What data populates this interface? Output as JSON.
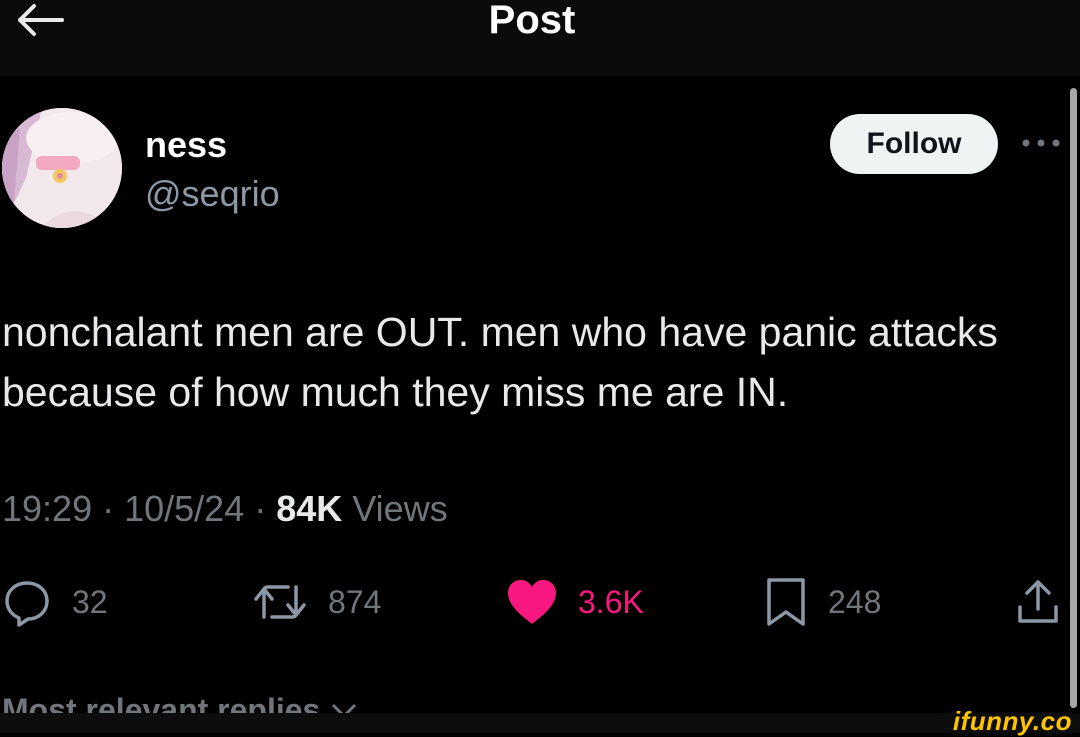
{
  "header": {
    "title": "Post"
  },
  "author": {
    "display_name": "ness",
    "handle": "@seqrio"
  },
  "follow_label": "Follow",
  "tweet": {
    "text": "nonchalant men are OUT. men who have panic attacks because of how much they miss me are IN."
  },
  "meta": {
    "time": "19:29",
    "date": "10/5/24",
    "views_count": "84K",
    "views_label": "Views"
  },
  "actions": {
    "replies": "32",
    "reposts": "874",
    "likes": "3.6K",
    "bookmarks": "248"
  },
  "replies_header": "Most relevant replies",
  "watermark": "ifunny.co",
  "icons": {
    "back": "arrow-left-icon",
    "more": "more-dots-icon",
    "reply": "reply-icon",
    "repost": "repost-icon",
    "like": "heart-icon",
    "bookmark": "bookmark-icon",
    "share": "share-icon",
    "chevron": "chevron-down-icon"
  },
  "colors": {
    "background": "#000000",
    "like": "#f91880",
    "muted": "#71767b",
    "follow_bg": "#eff3f4"
  }
}
